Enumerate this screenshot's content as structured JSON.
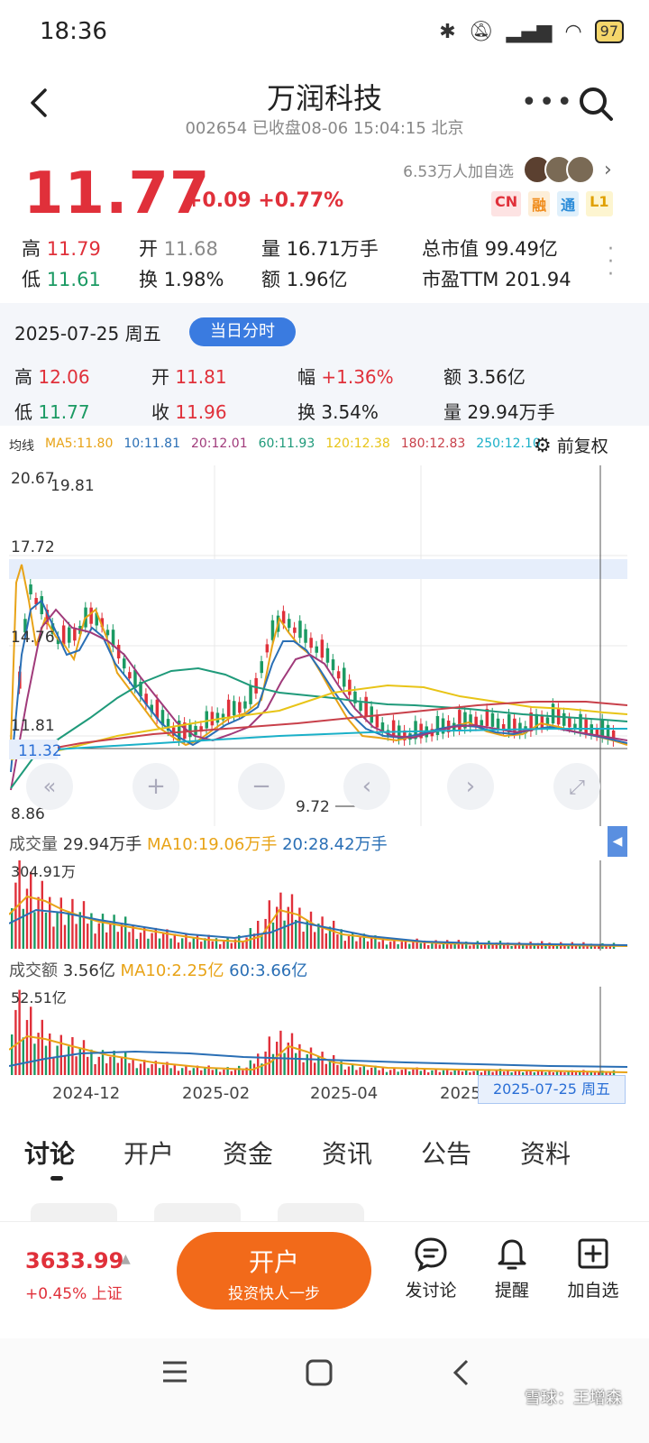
{
  "status_bar": {
    "time": "18:36",
    "battery": "97"
  },
  "header": {
    "title": "万润科技",
    "subtitle": "002654 已收盘08-06 15:04:15 北京"
  },
  "quote": {
    "price": "11.77",
    "change": "+0.09 +0.77%",
    "followers": "6.53万人加自选",
    "tags": [
      "CN",
      "融",
      "通",
      "L1"
    ],
    "high_label": "高",
    "high": "11.79",
    "low_label": "低",
    "low": "11.61",
    "open_label": "开",
    "open": "11.68",
    "turnover_label": "换",
    "turnover": "1.98%",
    "volume_label": "量",
    "volume": "16.71万手",
    "amount_label": "额",
    "amount": "1.96亿",
    "mktcap_label": "总市值",
    "mktcap": "99.49亿",
    "pe_label": "市盈TTM",
    "pe": "201.94"
  },
  "day_detail": {
    "date": "2025-07-25 周五",
    "button": "当日分时",
    "high_label": "高",
    "high": "12.06",
    "low_label": "低",
    "low": "11.77",
    "open_label": "开",
    "open": "11.81",
    "close_label": "收",
    "close": "11.96",
    "range_label": "幅",
    "range": "+1.36%",
    "turnover_label": "换",
    "turnover": "3.54%",
    "amount_label": "额",
    "amount": "3.56亿",
    "volume_label": "量",
    "volume": "29.94万手"
  },
  "ma_legend": {
    "label": "均线",
    "items": [
      {
        "text": "MA5:11.80",
        "color": "#e8a317"
      },
      {
        "text": "10:11.81",
        "color": "#2a6fb5"
      },
      {
        "text": "20:12.01",
        "color": "#a03a7a"
      },
      {
        "text": "60:11.93",
        "color": "#1f9a7a"
      },
      {
        "text": "120:12.38",
        "color": "#e8c417"
      },
      {
        "text": "180:12.83",
        "color": "#c8404a"
      },
      {
        "text": "250:12.10",
        "color": "#1ab0c8"
      }
    ],
    "adjust": "前复权"
  },
  "price_chart": {
    "labels": [
      "20.67",
      "19.81",
      "17.72",
      "14.76",
      "11.81",
      "11.32",
      "8.86",
      "9.72"
    ],
    "controls": [
      "«",
      "+",
      "−",
      "‹",
      "›",
      "⤢"
    ]
  },
  "volume_panel": {
    "label": "成交量",
    "value": "29.94万手",
    "ma10": "MA10:19.06万手",
    "ma20": "20:28.42万手",
    "max": "304.91万"
  },
  "amount_panel": {
    "label": "成交额",
    "value": "3.56亿",
    "ma10": "MA10:2.25亿",
    "ma60": "60:3.66亿",
    "max": "52.51亿"
  },
  "x_axis": [
    "2024-12",
    "2025-02",
    "2025-04",
    "2025"
  ],
  "selected_date_badge": "2025-07-25 周五",
  "tabs": [
    "讨论",
    "开户",
    "资金",
    "资讯",
    "公告",
    "资料"
  ],
  "bottom": {
    "index_value": "3633.99",
    "index_change": "+0.45% 上证",
    "open_main": "开户",
    "open_sub": "投资快人一步",
    "actions": [
      "发讨论",
      "提醒",
      "加自选"
    ]
  },
  "watermark": "雪球：王增森",
  "colors": {
    "up": "#e0303a",
    "down": "#1b9a63",
    "accent": "#3a7be0",
    "cta": "#f26a1a"
  }
}
